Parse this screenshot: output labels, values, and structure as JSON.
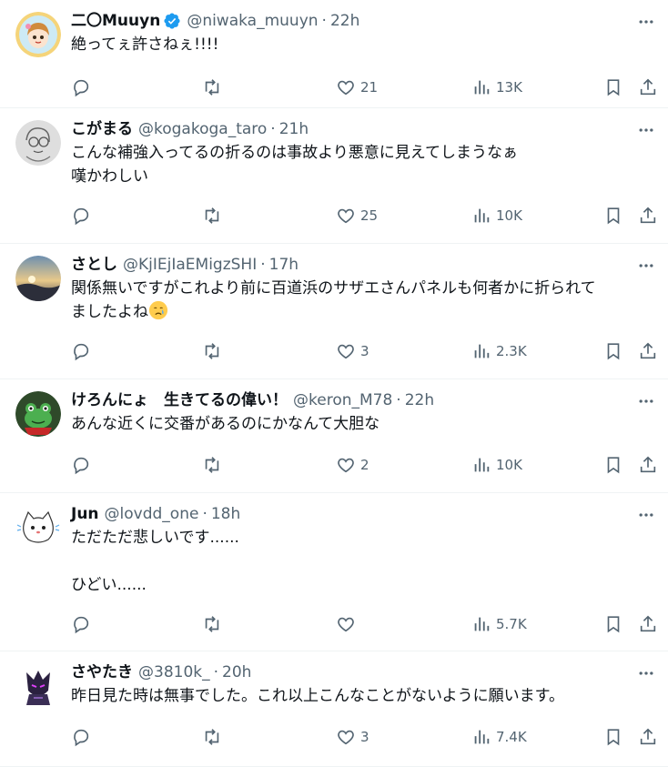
{
  "tweets": [
    {
      "name": "二〇Muuyn",
      "handle": "@niwaka_muuyn",
      "time": "22h",
      "verified": true,
      "text": "絶ってぇ許さねぇ!!!!",
      "replies": "",
      "retweets": "",
      "likes": "21",
      "views": "13K",
      "avatar": "anime-girl-avatar"
    },
    {
      "name": "こがまる",
      "handle": "@kogakoga_taro",
      "time": "21h",
      "text": "こんな補強入ってるの折るのは事故より悪意に見えてしまうなぁ\n嘆かわしい",
      "replies": "",
      "retweets": "",
      "likes": "25",
      "views": "10K",
      "avatar": "sketch-face-avatar"
    },
    {
      "name": "さとし",
      "handle": "@KjIEjIaEMigzSHI",
      "time": "17h",
      "text": "関係無いですがこれより前に百道浜のサザエさんパネルも何者かに折られて\nましたよね",
      "emoji": "crying-face-emoji",
      "replies": "",
      "retweets": "",
      "likes": "3",
      "views": "2.3K",
      "avatar": "sunset-landscape-avatar"
    },
    {
      "name": "けろんにょ　生きてるの偉い！",
      "handle": "@keron_M78",
      "time": "22h",
      "text": "あんな近くに交番があるのにかなんて大胆な",
      "replies": "",
      "retweets": "",
      "likes": "2",
      "views": "10K",
      "avatar": "frog-avatar"
    },
    {
      "name": "Jun",
      "handle": "@lovdd_one",
      "time": "18h",
      "text": "ただただ悲しいです......\n\nひどい......",
      "replies": "",
      "retweets": "",
      "likes": "",
      "views": "5.7K",
      "avatar": "white-cat-avatar"
    },
    {
      "name": "さやたき",
      "handle": "@3810k_",
      "time": "20h",
      "text": "昨日見た時は無事でした。これ以上こんなことがないように願います。",
      "replies": "",
      "retweets": "",
      "likes": "3",
      "views": "7.4K",
      "avatar": "dark-character-avatar"
    }
  ],
  "separator": "·",
  "colors": {
    "text": "#0f1419",
    "secondary": "#536471",
    "verified": "#1d9bf0",
    "border": "#eff3f4"
  }
}
